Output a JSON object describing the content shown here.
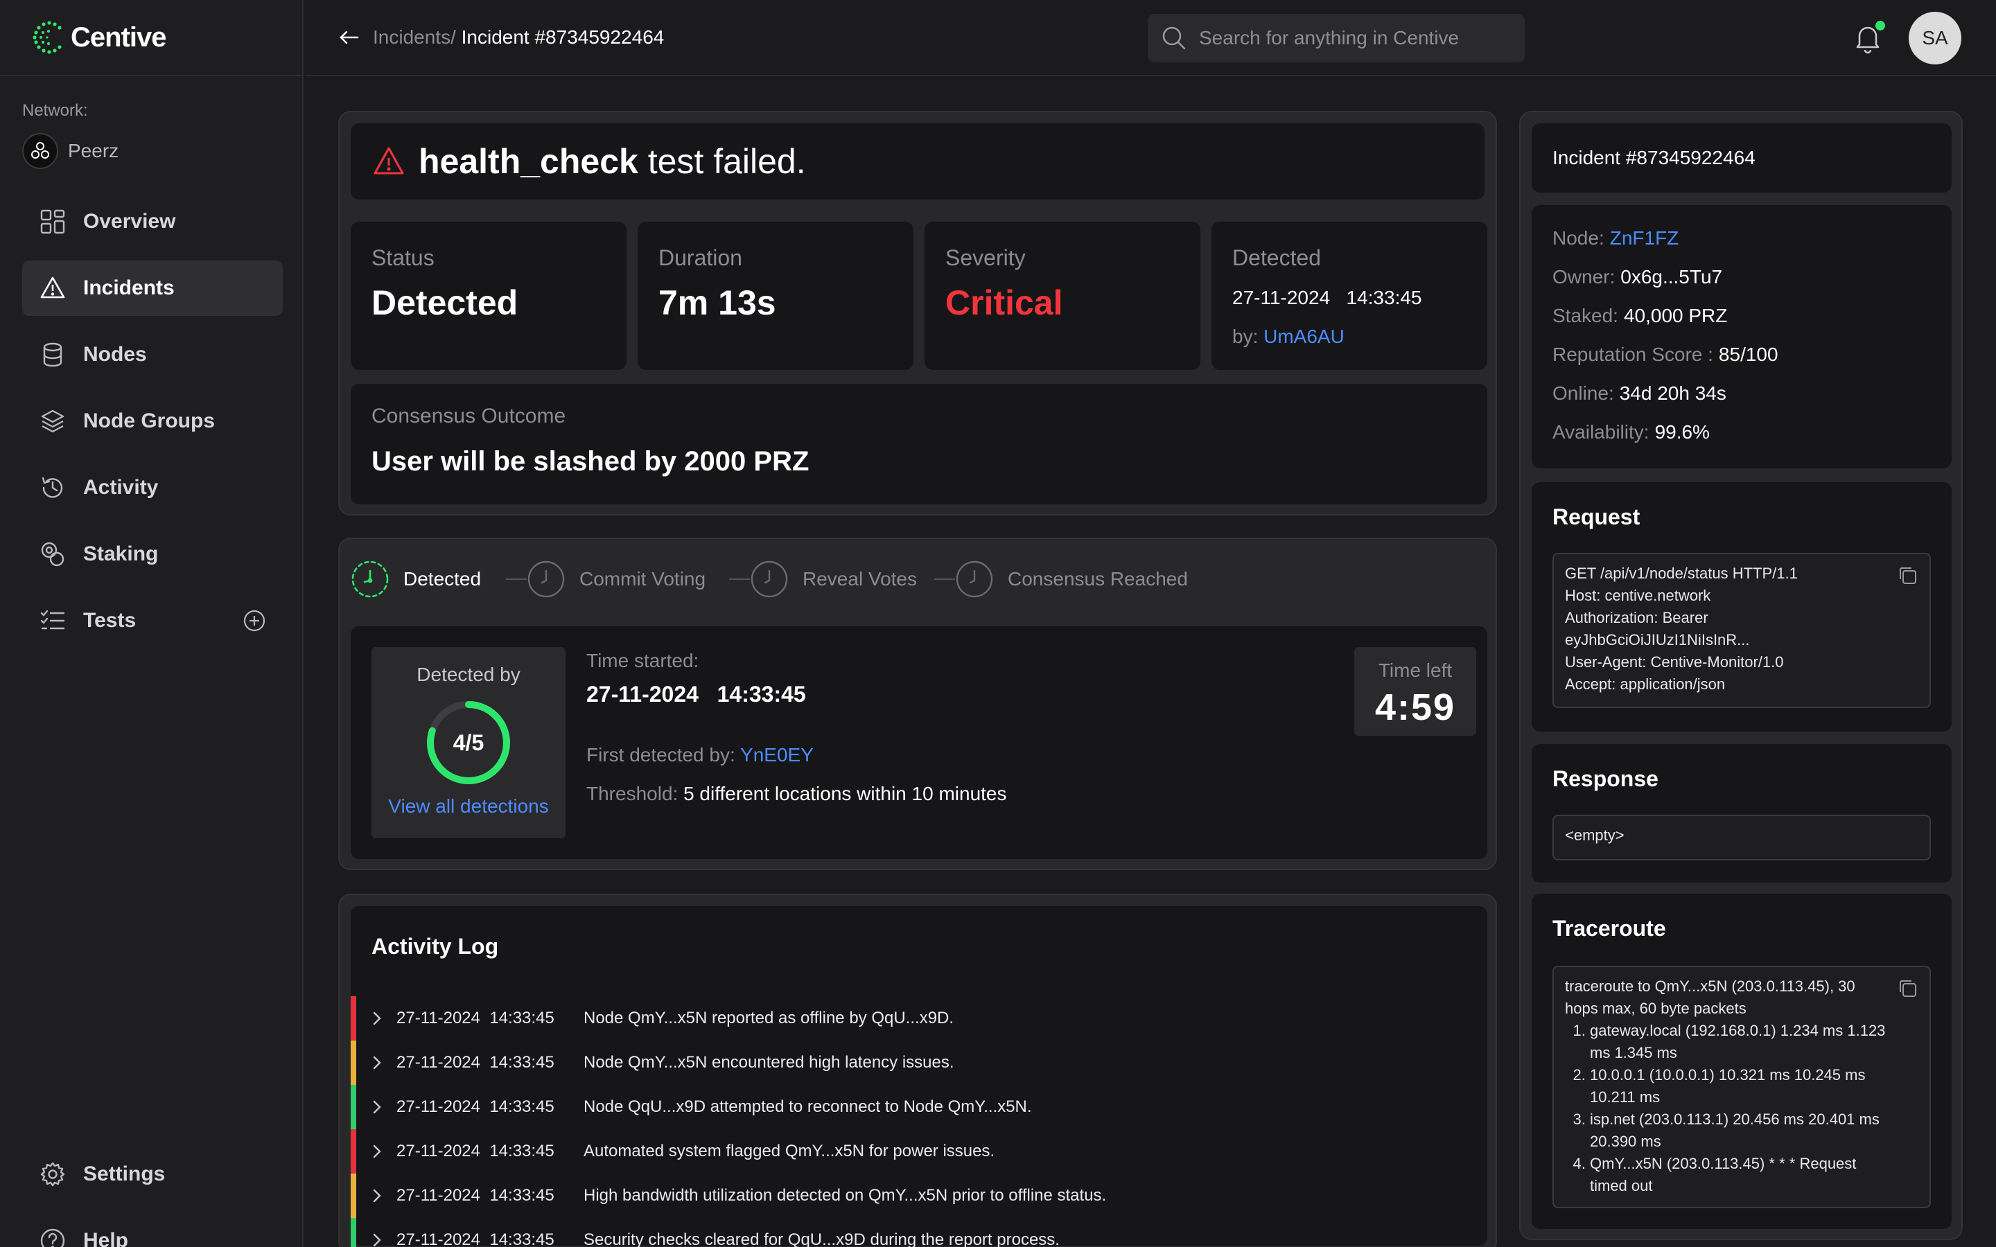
{
  "app": {
    "name": "Centive"
  },
  "sidebar": {
    "network_label": "Network:",
    "network_name": "Peerz",
    "items": [
      {
        "label": "Overview",
        "icon": "grid-icon"
      },
      {
        "label": "Incidents",
        "icon": "warning-icon",
        "active": true
      },
      {
        "label": "Nodes",
        "icon": "database-icon"
      },
      {
        "label": "Node Groups",
        "icon": "layers-icon"
      },
      {
        "label": "Activity",
        "icon": "history-icon"
      },
      {
        "label": "Staking",
        "icon": "coins-icon"
      },
      {
        "label": "Tests",
        "icon": "list-check-icon"
      }
    ],
    "bottom_items": [
      {
        "label": "Settings",
        "icon": "gear-icon"
      },
      {
        "label": "Help",
        "icon": "help-icon"
      }
    ]
  },
  "header": {
    "breadcrumb_parent": "Incidents/",
    "breadcrumb_current": "Incident #87345922464",
    "search_placeholder": "Search for anything in Centive",
    "user_initials": "SA"
  },
  "incident": {
    "title_bold": "health_check",
    "title_rest": " test failed.",
    "stats": {
      "status_label": "Status",
      "status_value": "Detected",
      "duration_label": "Duration",
      "duration_value": "7m 13s",
      "severity_label": "Severity",
      "severity_value": "Critical",
      "detected_label": "Detected",
      "detected_date": "27-11-2024",
      "detected_time": "14:33:45",
      "detected_by_label": "by:",
      "detected_by": "UmA6AU"
    },
    "consensus_label": "Consensus Outcome",
    "consensus_value": "User will be slashed by 2000 PRZ"
  },
  "timeline": {
    "steps": [
      "Detected",
      "Commit Voting",
      "Reveal Votes",
      "Consensus Reached"
    ],
    "detected_by_label": "Detected by",
    "detections_count": "4/5",
    "detections_fraction": 0.8,
    "view_all": "View all detections",
    "time_started_label": "Time started:",
    "time_started_date": "27-11-2024",
    "time_started_time": "14:33:45",
    "first_detected_label": "First detected by:",
    "first_detected_by": "YnE0EY",
    "threshold_label": "Threshold:",
    "threshold_value": "5 different locations within 10 minutes",
    "time_left_label": "Time left",
    "time_left_value": "4:59"
  },
  "activity_log": {
    "title": "Activity Log",
    "colors": {
      "red": "#e5313b",
      "yellow": "#e8b13a",
      "green": "#2ecf6b"
    },
    "rows": [
      {
        "date": "27-11-2024",
        "time": "14:33:45",
        "message": "Node QmY...x5N reported as offline by QqU...x9D.",
        "level": "red"
      },
      {
        "date": "27-11-2024",
        "time": "14:33:45",
        "message": "Node QmY...x5N encountered high latency issues.",
        "level": "yellow"
      },
      {
        "date": "27-11-2024",
        "time": "14:33:45",
        "message": "Node QqU...x9D attempted to reconnect to Node QmY...x5N.",
        "level": "green"
      },
      {
        "date": "27-11-2024",
        "time": "14:33:45",
        "message": "Automated system flagged QmY...x5N for power issues.",
        "level": "red"
      },
      {
        "date": "27-11-2024",
        "time": "14:33:45",
        "message": "High bandwidth utilization detected on QmY...x5N prior to offline status.",
        "level": "yellow"
      },
      {
        "date": "27-11-2024",
        "time": "14:33:45",
        "message": "Security checks cleared for QqU...x9D during the report process.",
        "level": "green"
      }
    ]
  },
  "details": {
    "incident_title": "Incident #87345922464",
    "node_label": "Node:",
    "node_value": "ZnF1FZ",
    "owner_label": "Owner:",
    "owner_value": "0x6g...5Tu7",
    "staked_label": "Staked:",
    "staked_value": "40,000 PRZ",
    "reputation_label": "Reputation Score :",
    "reputation_value": "85/100",
    "online_label": "Online:",
    "online_value": "34d 20h 34s",
    "availability_label": "Availability:",
    "availability_value": "99.6%"
  },
  "request": {
    "title": "Request",
    "lines": [
      "GET /api/v1/node/status HTTP/1.1",
      "Host: centive.network",
      "Authorization: Bearer",
      "eyJhbGciOiJIUzI1NiIsInR...",
      "User-Agent: Centive-Monitor/1.0",
      "Accept: application/json"
    ]
  },
  "response": {
    "title": "Response",
    "body": "<empty>"
  },
  "traceroute": {
    "title": "Traceroute",
    "intro": "traceroute to QmY...x5N (203.0.113.45), 30 hops max, 60 byte packets",
    "hops": [
      "gateway.local (192.168.0.1)  1.234 ms  1.123 ms  1.345 ms",
      "10.0.0.1 (10.0.0.1)  10.321 ms  10.245 ms  10.211 ms",
      "isp.net (203.0.113.1)  20.456 ms  20.401 ms  20.390 ms",
      "QmY...x5N (203.0.113.45) * * *  Request timed out"
    ]
  }
}
